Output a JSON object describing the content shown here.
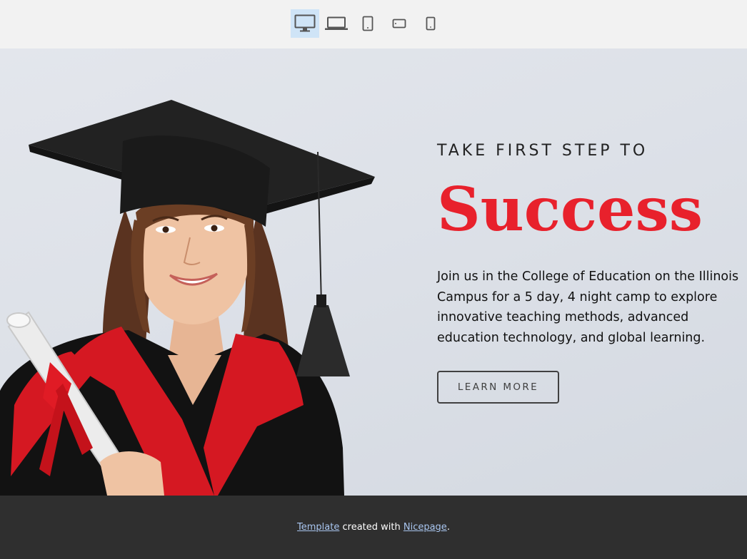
{
  "toolbar": {
    "devices": [
      {
        "icon": "desktop-icon",
        "active": true
      },
      {
        "icon": "laptop-icon",
        "active": false
      },
      {
        "icon": "tablet-icon",
        "active": false
      },
      {
        "icon": "tablet-landscape-icon",
        "active": false
      },
      {
        "icon": "phone-icon",
        "active": false
      }
    ],
    "active_color": "#cfe4f7"
  },
  "hero": {
    "eyebrow": "TAKE FIRST STEP TO",
    "headline": "Success",
    "headline_color": "#e8212c",
    "description": "Join us in the College of Education on the Illinois Campus for a 5 day, 4 night camp to explore innovative teaching methods, advanced education technology, and global learning.",
    "cta_label": "LEARN MORE",
    "image": "graduate-photo"
  },
  "footer": {
    "link1": "Template",
    "middle": " created with ",
    "link2": "Nicepage",
    "end": "."
  }
}
